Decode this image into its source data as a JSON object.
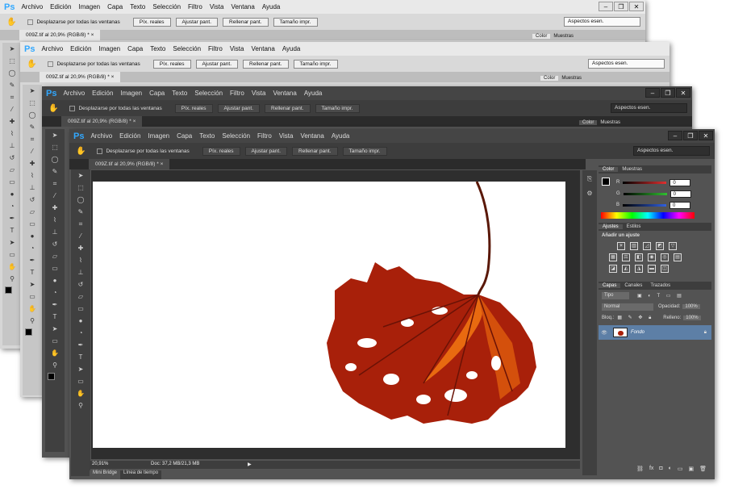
{
  "app": {
    "logo": "Ps",
    "menu": [
      "Archivo",
      "Edición",
      "Imagen",
      "Capa",
      "Texto",
      "Selección",
      "Filtro",
      "Vista",
      "Ventana",
      "Ayuda"
    ],
    "window_buttons": [
      "–",
      "❐",
      "✕"
    ]
  },
  "options_bar": {
    "checkbox_label": "Desplazarse por todas las ventanas",
    "buttons": [
      "Píx. reales",
      "Ajustar pant.",
      "Rellenar pant.",
      "Tamaño impr."
    ],
    "workspace_select": "Aspectos esen."
  },
  "document": {
    "tab_title": "009Z.tif al 20,9% (RGB/8) *",
    "tab_close": "×"
  },
  "panels": {
    "color_tabs": [
      "Color",
      "Muestras"
    ],
    "color_sliders": [
      {
        "label": "R",
        "value": "0",
        "color": "#e03030"
      },
      {
        "label": "G",
        "value": "0",
        "color": "#30c030"
      },
      {
        "label": "B",
        "value": "0",
        "color": "#3060e0"
      }
    ],
    "adjust_tabs": [
      "Ajustes",
      "Estilos"
    ],
    "adjust_title": "Añadir un ajuste",
    "layers_tabs": [
      "Capas",
      "Canales",
      "Trazados"
    ],
    "layers_filter": "Tipo",
    "blend_mode": "Normal",
    "opacity_label": "Opacidad:",
    "opacity_value": "100%",
    "lock_label": "Bloq.:",
    "fill_label": "Relleno:",
    "fill_value": "100%",
    "layer_name": "Fondo"
  },
  "status_bar": {
    "zoom": "20,91%",
    "doc_info": "Doc: 37,2 MB/21,3 MB",
    "bottom_tabs": [
      "Mini Bridge",
      "Línea de tiempo"
    ]
  },
  "colors": {
    "light_ui": "#d6d6d6",
    "dark_ui": "#535353",
    "ps_blue": "#31a8ff",
    "leaf_red": "#a8200a",
    "leaf_orange": "#e86a10",
    "stem": "#5a1808"
  },
  "tool_icons": [
    "move-icon",
    "marquee-icon",
    "lasso-icon",
    "quick-select-icon",
    "crop-icon",
    "eyedropper-icon",
    "healing-icon",
    "brush-icon",
    "stamp-icon",
    "history-brush-icon",
    "eraser-icon",
    "gradient-icon",
    "blur-icon",
    "dodge-icon",
    "pen-icon",
    "type-icon",
    "path-select-icon",
    "shape-icon",
    "hand-icon",
    "zoom-icon"
  ]
}
